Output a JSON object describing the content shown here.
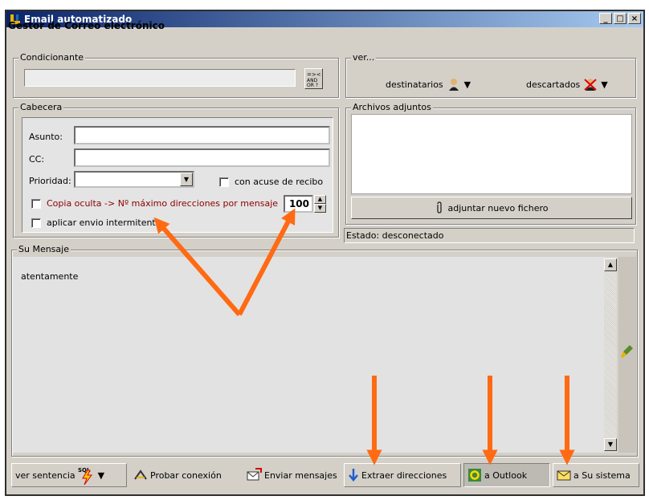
{
  "window": {
    "title": "Email automatizado",
    "subtitle": "Gestor de Correo electrónico",
    "min": "_",
    "max": "□",
    "close": "×"
  },
  "condicionante": {
    "label": "Condicionante",
    "value": "",
    "btn_icon": "and-or-icon"
  },
  "ver": {
    "label": "ver...",
    "destinatarios": "destinatarios",
    "descartados": "descartados"
  },
  "cabecera": {
    "label": "Cabecera",
    "asunto_label": "Asunto:",
    "asunto_value": "",
    "cc_label": "CC:",
    "cc_value": "",
    "prioridad_label": "Prioridad:",
    "prioridad_value": "",
    "acuse_label": "con acuse de recibo",
    "copia_label": "Copia oculta -> Nº máximo direcciones por mensaje",
    "copia_value": "100",
    "intermitente_label": "aplicar envio intermitente"
  },
  "adjuntos": {
    "label": "Archivos adjuntos",
    "button": "adjuntar nuevo fichero"
  },
  "estado": "Estado: desconectado",
  "mensaje": {
    "label": "Su Mensaje",
    "text": "atentamente"
  },
  "toolbar": {
    "ver_sentencia": "ver sentencia",
    "sql": "SQL",
    "probar": "Probar conexión",
    "enviar": "Enviar mensajes",
    "extraer": "Extraer direcciones",
    "outlook": "a Outlook",
    "sistema": "a Su sistema"
  },
  "colors": {
    "title_start": "#0a246a",
    "title_end": "#a6caf0",
    "annotation": "#ff6a13",
    "copia_text": "#8b0000"
  }
}
